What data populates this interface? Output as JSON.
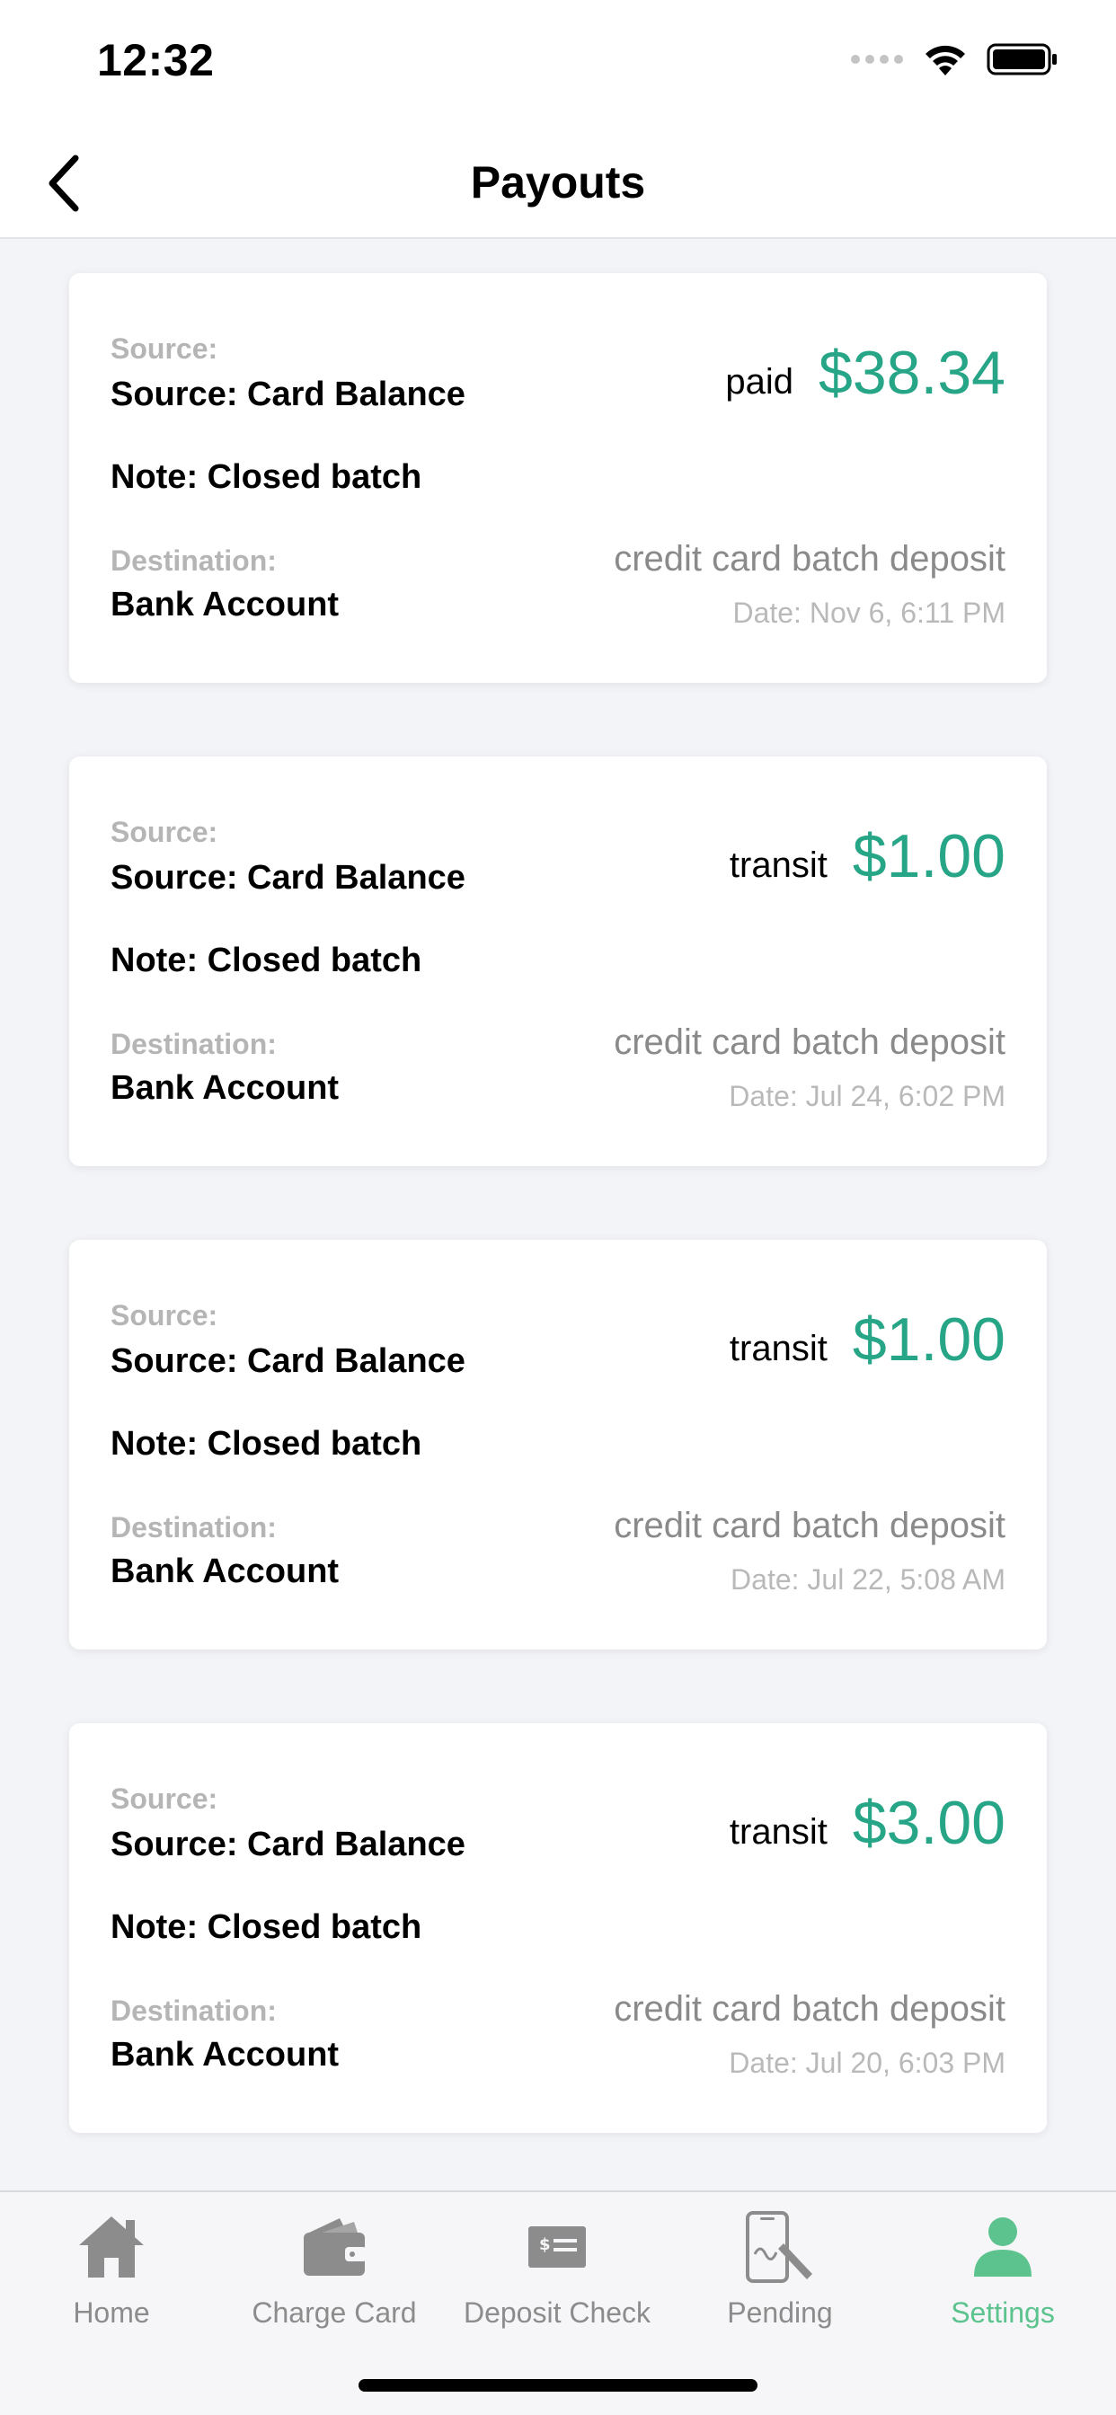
{
  "status_bar": {
    "time": "12:32"
  },
  "nav": {
    "title": "Payouts"
  },
  "payouts": [
    {
      "source_label": "Source:",
      "source_value": "Source: Card Balance",
      "note": "Note: Closed batch",
      "destination_label": "Destination:",
      "destination_value": "Bank Account",
      "status": "paid",
      "amount": "$38.34",
      "type": "credit card batch deposit",
      "date": "Date: Nov  6,  6:11 PM"
    },
    {
      "source_label": "Source:",
      "source_value": "Source: Card Balance",
      "note": "Note: Closed batch",
      "destination_label": "Destination:",
      "destination_value": "Bank Account",
      "status": "transit",
      "amount": "$1.00",
      "type": "credit card batch deposit",
      "date": "Date: Jul 24,  6:02 PM"
    },
    {
      "source_label": "Source:",
      "source_value": "Source: Card Balance",
      "note": "Note: Closed batch",
      "destination_label": "Destination:",
      "destination_value": "Bank Account",
      "status": "transit",
      "amount": "$1.00",
      "type": "credit card batch deposit",
      "date": "Date: Jul 22,  5:08 AM"
    },
    {
      "source_label": "Source:",
      "source_value": "Source: Card Balance",
      "note": "Note: Closed batch",
      "destination_label": "Destination:",
      "destination_value": "Bank Account",
      "status": "transit",
      "amount": "$3.00",
      "type": "credit card batch deposit",
      "date": "Date: Jul 20,  6:03 PM"
    }
  ],
  "tabs": [
    {
      "label": "Home",
      "icon": "home-icon"
    },
    {
      "label": "Charge Card",
      "icon": "wallet-icon"
    },
    {
      "label": "Deposit Check",
      "icon": "check-icon"
    },
    {
      "label": "Pending",
      "icon": "phone-sign-icon"
    },
    {
      "label": "Settings",
      "icon": "user-icon",
      "active": true
    }
  ],
  "colors": {
    "accent_amount": "#27a587",
    "active_tab": "#5cc38f",
    "inactive_tab": "#8c8c8c",
    "background": "#f3f4f8"
  }
}
